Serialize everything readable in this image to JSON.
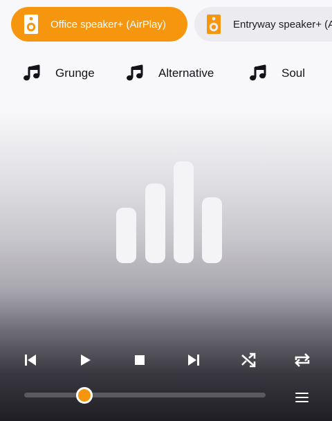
{
  "speakers": [
    {
      "label": "Office speaker+ (AirPlay)",
      "active": true,
      "icon": "speaker-icon"
    },
    {
      "label": "Entryway speaker+ (A",
      "active": false,
      "icon": "speaker-icon"
    }
  ],
  "genres": [
    {
      "label": "Grunge",
      "icon": "music-note-icon"
    },
    {
      "label": "Alternative",
      "icon": "music-note-icon"
    },
    {
      "label": "Soul",
      "icon": "music-note-icon"
    }
  ],
  "controls": [
    "skip-previous-icon",
    "play-icon",
    "stop-icon",
    "skip-next-icon",
    "shuffle-icon",
    "repeat-icon"
  ],
  "seek": {
    "progress": 0.25
  },
  "colors": {
    "accent": "#f6950e",
    "inactive_chip": "#ececf0"
  }
}
